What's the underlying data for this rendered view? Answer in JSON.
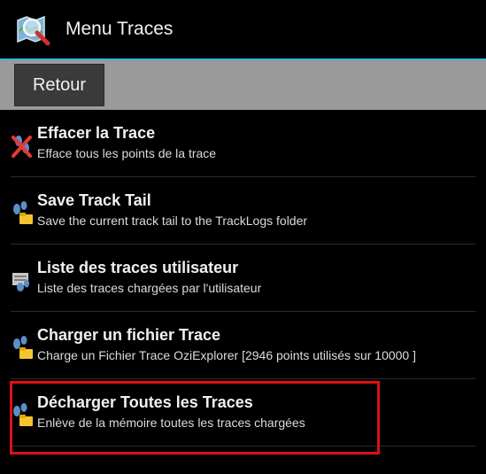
{
  "app": {
    "title": "Menu Traces",
    "icon": "map-search-icon"
  },
  "toolbar": {
    "back_label": "Retour"
  },
  "menu": {
    "items": [
      {
        "title": "Effacer la Trace",
        "description": "Efface tous les points de la trace",
        "icon": "erase-footprints-icon"
      },
      {
        "title": "Save Track Tail",
        "description": "Save the current track tail to the TrackLogs folder",
        "icon": "footprints-folder-icon"
      },
      {
        "title": "Liste des traces utilisateur",
        "description": "Liste des traces chargées par l'utilisateur",
        "icon": "footprints-list-icon"
      },
      {
        "title": "Charger un fichier Trace",
        "description": "Charge un Fichier Trace OziExplorer [2946 points utilisés sur 10000 ]",
        "icon": "footprints-folder-icon"
      },
      {
        "title": "Décharger Toutes les Traces",
        "description": "Enlève de la mémoire toutes les traces chargées",
        "icon": "footprints-folder-icon"
      }
    ]
  },
  "colors": {
    "accent_line": "#33b5e5",
    "highlight": "#e01010",
    "toolbar_bg": "#9a9a9a",
    "background": "#000000"
  }
}
